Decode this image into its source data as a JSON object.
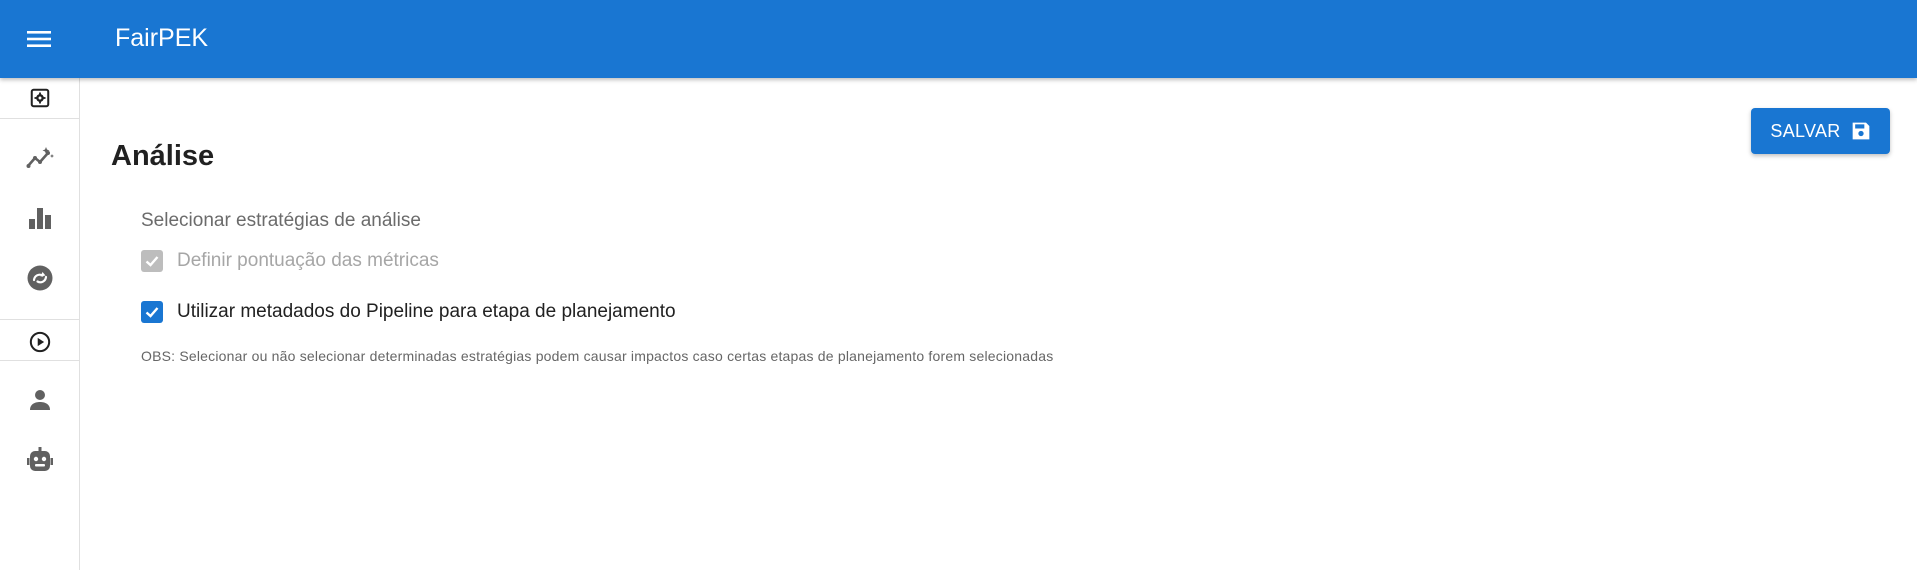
{
  "app": {
    "title": "FairPEK"
  },
  "header": {
    "menu_icon": "hamburger-menu-icon"
  },
  "sidebar": {
    "items": [
      {
        "icon": "settings-box-icon"
      },
      {
        "icon": "analytics-sparkle-icon"
      },
      {
        "icon": "bar-chart-icon"
      },
      {
        "icon": "refresh-circle-icon"
      },
      {
        "icon": "play-circle-icon"
      },
      {
        "icon": "person-icon"
      },
      {
        "icon": "robot-icon"
      }
    ]
  },
  "page": {
    "title": "Análise",
    "save_label": "SALVAR",
    "save_icon": "floppy-disk-icon",
    "section_label": "Selecionar estratégias de análise",
    "options": [
      {
        "label": "Definir pontuação das métricas",
        "checked": true,
        "disabled": true
      },
      {
        "label": "Utilizar metadados do Pipeline para etapa de planejamento",
        "checked": true,
        "disabled": false
      }
    ],
    "note": "OBS: Selecionar ou não selecionar determinadas estratégias podem causar impactos caso certas etapas de planejamento forem selecionadas"
  },
  "colors": {
    "primary": "#1976d2",
    "disabled": "#bdbdbd",
    "icon": "#616161"
  }
}
